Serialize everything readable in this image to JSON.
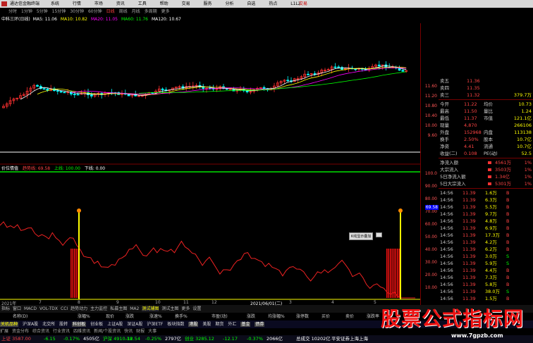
{
  "titlebar": {
    "app_name": "通达信金融终端",
    "menu": [
      "系统",
      "行情",
      "市场",
      "资讯",
      "工具",
      "帮助",
      "交易",
      "服务",
      "分析",
      "自选",
      "热点",
      "L1L2"
    ],
    "right_label": "交易"
  },
  "toolbar": {
    "periods": [
      "分时",
      "1分钟",
      "5分钟",
      "15分钟",
      "30分钟",
      "60分钟",
      "日线",
      "周线",
      "月线",
      "多周期",
      "更多"
    ],
    "active": "日线"
  },
  "ma_legend": {
    "stock": "中科三环(日线)",
    "items": [
      {
        "label": "MA5: 11.06",
        "color": "#ffffff"
      },
      {
        "label": "MA10: 10.82",
        "color": "#ffff00"
      },
      {
        "label": "MA20: 11.05",
        "color": "#ff00ff"
      },
      {
        "label": "MA60: 11.76",
        "color": "#00ff00"
      },
      {
        "label": "MA120: 10.67",
        "color": "#ffffff"
      }
    ]
  },
  "price_axis": [
    "11.60",
    "11.20",
    "10.80",
    "10.40",
    "10.00",
    "9.60"
  ],
  "ind_axis": [
    "100.0",
    "90.00",
    "80.00",
    "70.00",
    "60.00",
    "50.00",
    "40.00",
    "30.00",
    "20.00",
    "10.00"
  ],
  "axis_marker": "69.58",
  "indicator_legend": {
    "name": "价位情值",
    "val1": "趋势线: 69.58",
    "up": "上线: 100.00",
    "down": "下线: 0.00"
  },
  "popup_label": "K线显示叠加",
  "dates": [
    "2021年",
    "7",
    "8",
    "9",
    "10",
    "11",
    "12",
    "2021/06/01(二)",
    "3",
    "4",
    "5"
  ],
  "quotes": [
    {
      "l": "卖五",
      "v": "11.36",
      "q": "",
      "c": "#f44"
    },
    {
      "l": "卖四",
      "v": "11.35",
      "q": "",
      "c": "#f44"
    },
    {
      "l": "卖三",
      "v": "11.32",
      "q": "379.7万",
      "c": "#f44"
    }
  ],
  "stats": [
    {
      "l1": "今开",
      "v1": "11.22",
      "l2": "均价",
      "v2": "10.73"
    },
    {
      "l1": "最高",
      "v1": "11.50",
      "l2": "量比",
      "v2": "1.24"
    },
    {
      "l1": "最低",
      "v1": "11.37",
      "l2": "市值",
      "v2": "121.1亿"
    },
    {
      "l1": "现量",
      "v1": "4,870",
      "l2": "",
      "v2": "266106"
    },
    {
      "l1": "外盘",
      "v1": "152968",
      "l2": "内盘",
      "v2": "113138"
    },
    {
      "l1": "换手",
      "v1": "2.50%",
      "l2": "股本",
      "v2": "10.7亿"
    },
    {
      "l1": "净资",
      "v1": "4.41",
      "l2": "流通",
      "v2": "10.7亿"
    },
    {
      "l1": "收益(二)",
      "v1": "0.108",
      "l2": "PE(动)",
      "v2": "52.5"
    }
  ],
  "flows": [
    {
      "l": "净流入额",
      "v": "4561万",
      "p": "1%"
    },
    {
      "l": "大宗流入",
      "v": "3503万",
      "p": "1%"
    },
    {
      "l": "5日净流入额",
      "v": "1.34亿",
      "p": "1%"
    },
    {
      "l": "5日大宗流入",
      "v": "5301万",
      "p": "1%"
    }
  ],
  "ticks": [
    {
      "t": "14:56",
      "p": "11.39",
      "v": "1.6万",
      "d": "B"
    },
    {
      "t": "14:56",
      "p": "11.39",
      "v": "6.3万",
      "d": "B"
    },
    {
      "t": "14:56",
      "p": "11.39",
      "v": "5.5万",
      "d": "B"
    },
    {
      "t": "14:56",
      "p": "11.39",
      "v": "9.7万",
      "d": "B"
    },
    {
      "t": "14:56",
      "p": "11.39",
      "v": "4.8万",
      "d": "B"
    },
    {
      "t": "14:56",
      "p": "11.39",
      "v": "6.9万",
      "d": "B"
    },
    {
      "t": "14:56",
      "p": "11.39",
      "v": "17.3万",
      "d": "B"
    },
    {
      "t": "14:56",
      "p": "11.39",
      "v": "4.2万",
      "d": "B"
    },
    {
      "t": "14:56",
      "p": "11.39",
      "v": "6.2万",
      "d": "B"
    },
    {
      "t": "14:56",
      "p": "11.39",
      "v": "3.0万",
      "d": "S"
    },
    {
      "t": "14:56",
      "p": "11.39",
      "v": "5.9万",
      "d": "S"
    },
    {
      "t": "14:56",
      "p": "11.39",
      "v": "4.4万",
      "d": "B"
    },
    {
      "t": "14:56",
      "p": "11.39",
      "v": "7.3万",
      "d": "B"
    },
    {
      "t": "14:56",
      "p": "11.39",
      "v": "5.8万",
      "d": "B"
    },
    {
      "t": "14:56",
      "p": "11.39",
      "v": "38.0万",
      "d": "S"
    },
    {
      "t": "14:56",
      "p": "11.39",
      "v": "1.5万",
      "d": "B"
    }
  ],
  "tabs_row1": [
    "指标",
    "窗口",
    "MACD",
    "VOL-TDX",
    "CCI",
    "趋势动力",
    "主力监控",
    "私募主图",
    "MA2",
    "测试辅图",
    "测试主图",
    "更多",
    "设置"
  ],
  "tabs_row1_active": "测试辅图",
  "tabs_row2": [
    "名称(D)",
    "涨幅%",
    "现价",
    "涨跌",
    "涨速%",
    "换手%",
    "市盈(动)",
    "涨跌",
    "均涨幅%",
    "涨停数",
    "买价",
    "卖价",
    "涨跌率"
  ],
  "tabs_row3": [
    "关机品种",
    "沪深A股",
    "北交所",
    "股转",
    "科创板",
    "创业板",
    "上证A股",
    "深证A股",
    "沪深ETF",
    "板块指数",
    "港股",
    "美股",
    "期货",
    "外汇",
    "基金",
    "债券"
  ],
  "tabs_row3_highlight": [
    "关机品种",
    "科创板",
    "港股",
    "基金",
    "债券"
  ],
  "tabs_row4": [
    "扩展",
    "资金分布",
    "综合资讯",
    "行业资讯",
    "四维资讯",
    "新闻/个股资讯",
    "快讯",
    "财报",
    "大事"
  ],
  "status": [
    {
      "l": "上证",
      "v": "3587.00",
      "c": "#f44"
    },
    {
      "l": "",
      "v": "-6.15",
      "c": "#0f0"
    },
    {
      "l": "",
      "v": "-0.17%",
      "c": "#0f0"
    },
    {
      "l": "",
      "v": "4505亿",
      "c": "#fff"
    },
    {
      "l": "沪深",
      "v": "4910.18",
      "c": "#0f0"
    },
    {
      "l": "",
      "v": "-12.54",
      "c": "#0f0"
    },
    {
      "l": "",
      "v": "-0.25%",
      "c": "#0f0"
    },
    {
      "l": "",
      "v": "2797亿",
      "c": "#fff"
    },
    {
      "l": "创业",
      "v": "3285.12",
      "c": "#0f0"
    },
    {
      "l": "",
      "v": "-12.17",
      "c": "#0f0"
    },
    {
      "l": "",
      "v": "-0.37%",
      "c": "#0f0"
    },
    {
      "l": "",
      "v": "2066亿",
      "c": "#fff"
    },
    {
      "l": "总成交",
      "v": "10202亿",
      "c": "#fff"
    },
    {
      "l": "",
      "v": "平安证券上海上海",
      "c": "#fff"
    }
  ],
  "watermark": {
    "text": "股票公式指标网",
    "url": "www.7gpzb.com"
  },
  "colors": {
    "up": "#ff3030",
    "down": "#00c000",
    "bg": "#000000",
    "ma5": "#ffffff",
    "ma10": "#ffff00",
    "ma20": "#ff00ff",
    "ma60": "#00ff00"
  }
}
